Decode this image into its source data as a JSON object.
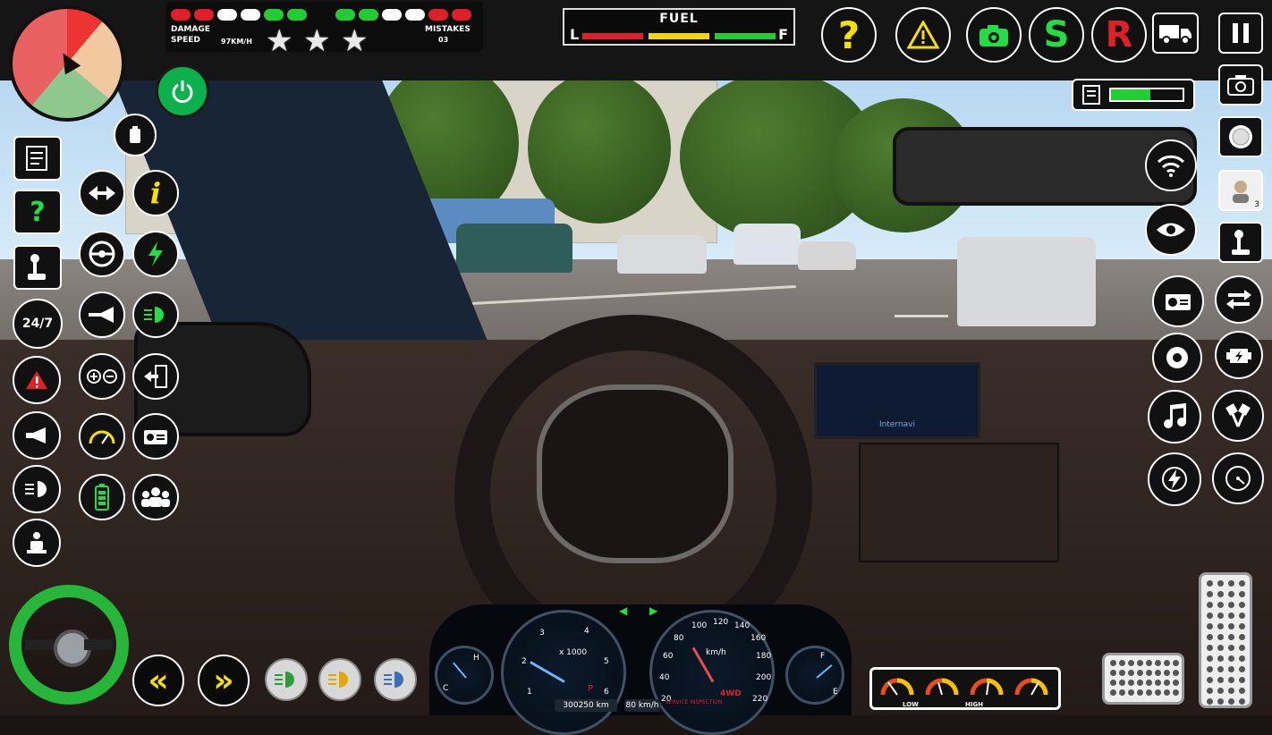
{
  "hud": {
    "damage_label": "DAMAGE",
    "speed_label": "SPEED",
    "speed_value": "97KM/H",
    "mistakes_label": "MISTAKES",
    "mistakes_value": "03",
    "stars": 3,
    "fuel_label": "FUEL",
    "fuel_low": "L",
    "fuel_full": "F",
    "help_symbol": "?",
    "s_label": "S",
    "r_label": "R",
    "camera_badge": "3",
    "clock_label": "24/7"
  },
  "damage_lights": [
    "#e01f26",
    "#e01f26",
    "#ffffff",
    "#ffffff",
    "#22cc33",
    "#22cc33"
  ],
  "mistake_lights": [
    "#22cc33",
    "#22cc33",
    "#ffffff",
    "#ffffff",
    "#e01f26",
    "#e01f26"
  ],
  "icons": {
    "top_right": [
      "help-icon",
      "warning-icon",
      "camera-icon",
      "start-icon",
      "reverse-icon",
      "truck-icon",
      "pause-icon"
    ],
    "left_column": [
      "notes-icon",
      "question-icon",
      "gear-shift-icon",
      "clock-24-7-icon",
      "hazard-icon",
      "horn-icon",
      "headlight-icon",
      "seat-belt-icon"
    ],
    "left_grid": [
      "indicator-icon",
      "info-icon",
      "steering-icon",
      "lightning-icon",
      "horn-icon",
      "high-beam-icon",
      "zoom-icon",
      "exit-door-icon",
      "speedometer-icon",
      "radio-icon",
      "battery-icon",
      "passengers-icon"
    ],
    "right_column": [
      "camera-icon",
      "settings-icon",
      "driver-icon",
      "gear-shift-icon",
      "wifi-icon",
      "eye-icon",
      "radio-icon",
      "transfer-icon",
      "turbo-icon",
      "engine-icon",
      "music-icon",
      "piston-icon",
      "boost-icon",
      "gauge-icon"
    ]
  },
  "dashboard": {
    "rpm_scale": "x 1000",
    "speed_unit": "km/h",
    "drive_mode": "4WD",
    "odometer": "300250",
    "odometer_unit": "km",
    "cruise_speed": "80",
    "cruise_unit": "km/h",
    "service_label": "SERVICE INSPECTION",
    "rpm_ticks": [
      "1",
      "2",
      "3",
      "4",
      "5",
      "6"
    ],
    "speed_ticks": [
      "20",
      "40",
      "60",
      "80",
      "100",
      "120",
      "140",
      "160",
      "180",
      "200",
      "220"
    ],
    "temp_labels": [
      "H",
      "C"
    ],
    "fuel_labels": [
      "F",
      "E"
    ],
    "gear_label": "P",
    "brand_screen": "Internavi"
  },
  "gear_panel": {
    "low_label": "LOW",
    "high_label": "HIGH"
  },
  "fuel_level": 0.82,
  "battery_level": 0.55
}
